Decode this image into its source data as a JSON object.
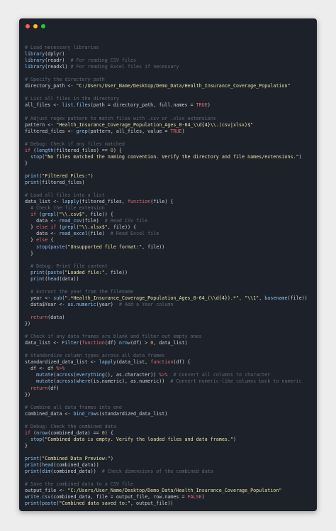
{
  "window": {
    "controls": [
      {
        "name": "close-dot",
        "color": "#ff5f56"
      },
      {
        "name": "minimize-dot",
        "color": "#ffbd2e"
      },
      {
        "name": "maximize-dot",
        "color": "#27c93f"
      }
    ]
  },
  "colors": {
    "background": "#1d2129",
    "comment": "#5f6a7a",
    "string": "#e8e1a6",
    "keyword": "#e06c75",
    "function": "#8cc3f5",
    "number": "#e4b679",
    "text": "#ccd2dc"
  },
  "code": [
    [],
    [
      [
        "cmt",
        "# Load necessary libraries"
      ]
    ],
    [
      [
        "fn",
        "library"
      ],
      [
        "op",
        "(dplyr)"
      ]
    ],
    [
      [
        "fn",
        "library"
      ],
      [
        "op",
        "(readr)  "
      ],
      [
        "cmt",
        "# For reading CSV files"
      ]
    ],
    [
      [
        "fn",
        "library"
      ],
      [
        "op",
        "(readxl) "
      ],
      [
        "cmt",
        "# For reading Excel files if necessary"
      ]
    ],
    [],
    [
      [
        "cmt",
        "# Specify the directory path"
      ]
    ],
    [
      [
        "id",
        "directory_path "
      ],
      [
        "op",
        "<- "
      ],
      [
        "str",
        "\"C:/Users/User_Name/Desktop/Demo_Data/Health_Insurance_Coverage_Population\""
      ]
    ],
    [],
    [
      [
        "cmt",
        "# List all files in the directory"
      ]
    ],
    [
      [
        "id",
        "all_files "
      ],
      [
        "op",
        "<- "
      ],
      [
        "fn",
        "list.files"
      ],
      [
        "op",
        "(path = directory_path, full.names = "
      ],
      [
        "kw",
        "TRUE"
      ],
      [
        "op",
        ")"
      ]
    ],
    [],
    [
      [
        "cmt",
        "# Adjust regex pattern to match files with .csv or .xlsx extensions"
      ]
    ],
    [
      [
        "id",
        "pattern "
      ],
      [
        "op",
        "<- "
      ],
      [
        "str",
        "\"Health_Insurance_Coverage_Population_Ages_0-64_\\\\d{4}\\\\.(csv|xlsx)$\""
      ]
    ],
    [
      [
        "id",
        "filtered_files "
      ],
      [
        "op",
        "<- "
      ],
      [
        "fn",
        "grep"
      ],
      [
        "op",
        "(pattern, all_files, value = "
      ],
      [
        "kw",
        "TRUE"
      ],
      [
        "op",
        ")"
      ]
    ],
    [],
    [
      [
        "cmt",
        "# Debug: Check if any files matched"
      ]
    ],
    [
      [
        "kw",
        "if"
      ],
      [
        "op",
        " ("
      ],
      [
        "fn",
        "length"
      ],
      [
        "op",
        "(filtered_files) == "
      ],
      [
        "num",
        "0"
      ],
      [
        "op",
        ") {"
      ]
    ],
    [
      [
        "op",
        "  "
      ],
      [
        "fn",
        "stop"
      ],
      [
        "op",
        "("
      ],
      [
        "str",
        "\"No files matched the naming convention. Verify the directory and file names/extensions.\""
      ],
      [
        "op",
        ")"
      ]
    ],
    [
      [
        "op",
        "}"
      ]
    ],
    [],
    [
      [
        "fn",
        "print"
      ],
      [
        "op",
        "("
      ],
      [
        "str",
        "\"Filtered Files:\""
      ],
      [
        "op",
        ")"
      ]
    ],
    [
      [
        "fn",
        "print"
      ],
      [
        "op",
        "(filtered_files)"
      ]
    ],
    [],
    [
      [
        "cmt",
        "# Load all files into a list"
      ]
    ],
    [
      [
        "id",
        "data_list "
      ],
      [
        "op",
        "<- "
      ],
      [
        "fn",
        "lapply"
      ],
      [
        "op",
        "(filtered_files, "
      ],
      [
        "kw",
        "function"
      ],
      [
        "op",
        "(file) {"
      ]
    ],
    [
      [
        "op",
        "  "
      ],
      [
        "cmt",
        "# Check the file extension"
      ]
    ],
    [
      [
        "op",
        "  "
      ],
      [
        "kw",
        "if"
      ],
      [
        "op",
        " ("
      ],
      [
        "fn",
        "grepl"
      ],
      [
        "op",
        "("
      ],
      [
        "str",
        "\"\\\\.csv$\""
      ],
      [
        "op",
        ", file)) {"
      ]
    ],
    [
      [
        "op",
        "    data <- "
      ],
      [
        "fn",
        "read_csv"
      ],
      [
        "op",
        "(file)  "
      ],
      [
        "cmt",
        "# Read CSV file"
      ]
    ],
    [
      [
        "op",
        "  } "
      ],
      [
        "kw",
        "else if"
      ],
      [
        "op",
        " ("
      ],
      [
        "fn",
        "grepl"
      ],
      [
        "op",
        "("
      ],
      [
        "str",
        "\"\\\\.xlsx$\""
      ],
      [
        "op",
        ", file)) {"
      ]
    ],
    [
      [
        "op",
        "    data <- "
      ],
      [
        "fn",
        "read_excel"
      ],
      [
        "op",
        "(file)  "
      ],
      [
        "cmt",
        "# Read Excel file"
      ]
    ],
    [
      [
        "op",
        "  } "
      ],
      [
        "kw",
        "else"
      ],
      [
        "op",
        " {"
      ]
    ],
    [
      [
        "op",
        "    "
      ],
      [
        "fn",
        "stop"
      ],
      [
        "op",
        "("
      ],
      [
        "fn",
        "paste"
      ],
      [
        "op",
        "("
      ],
      [
        "str",
        "\"Unsupported file format:\""
      ],
      [
        "op",
        ", file))"
      ]
    ],
    [
      [
        "op",
        "  }"
      ]
    ],
    [],
    [
      [
        "op",
        "  "
      ],
      [
        "cmt",
        "# Debug: Print file content"
      ]
    ],
    [
      [
        "op",
        "  "
      ],
      [
        "fn",
        "print"
      ],
      [
        "op",
        "("
      ],
      [
        "fn",
        "paste"
      ],
      [
        "op",
        "("
      ],
      [
        "str",
        "\"Loaded file:\""
      ],
      [
        "op",
        ", file))"
      ]
    ],
    [
      [
        "op",
        "  "
      ],
      [
        "fn",
        "print"
      ],
      [
        "op",
        "("
      ],
      [
        "fn",
        "head"
      ],
      [
        "op",
        "(data))"
      ]
    ],
    [],
    [
      [
        "op",
        "  "
      ],
      [
        "cmt",
        "# Extract the year from the filename"
      ]
    ],
    [
      [
        "op",
        "  year <- "
      ],
      [
        "fn",
        "sub"
      ],
      [
        "op",
        "("
      ],
      [
        "str",
        "\".*Health_Insurance_Coverage_Population_Ages_0-64_(\\\\d{4}).*\""
      ],
      [
        "op",
        ", "
      ],
      [
        "str",
        "\"\\\\1\""
      ],
      [
        "op",
        ", "
      ],
      [
        "fn",
        "basename"
      ],
      [
        "op",
        "(file))"
      ]
    ],
    [
      [
        "op",
        "  data$Year <- "
      ],
      [
        "fn",
        "as.numeric"
      ],
      [
        "op",
        "(year)  "
      ],
      [
        "cmt",
        "# Add a Year column"
      ]
    ],
    [],
    [
      [
        "op",
        "  "
      ],
      [
        "kw",
        "return"
      ],
      [
        "op",
        "(data)"
      ]
    ],
    [
      [
        "op",
        "})"
      ]
    ],
    [],
    [
      [
        "cmt",
        "# Check if any data frames are blank and filter out empty ones"
      ]
    ],
    [
      [
        "id",
        "data_list "
      ],
      [
        "op",
        "<- "
      ],
      [
        "fn",
        "Filter"
      ],
      [
        "op",
        "("
      ],
      [
        "kw",
        "function"
      ],
      [
        "op",
        "(df) "
      ],
      [
        "fn",
        "nrow"
      ],
      [
        "op",
        "(df) > "
      ],
      [
        "num",
        "0"
      ],
      [
        "op",
        ", data_list)"
      ]
    ],
    [],
    [
      [
        "cmt",
        "# Standardize column types across all data frames"
      ]
    ],
    [
      [
        "id",
        "standardized_data_list "
      ],
      [
        "op",
        "<- "
      ],
      [
        "fn",
        "lapply"
      ],
      [
        "op",
        "(data_list, "
      ],
      [
        "kw",
        "function"
      ],
      [
        "op",
        "(df) {"
      ]
    ],
    [
      [
        "op",
        "  df <- df "
      ],
      [
        "kw",
        "%>%"
      ]
    ],
    [
      [
        "op",
        "    "
      ],
      [
        "fn",
        "mutate"
      ],
      [
        "op",
        "("
      ],
      [
        "fn",
        "across"
      ],
      [
        "op",
        "("
      ],
      [
        "fn",
        "everything"
      ],
      [
        "op",
        "(), as.character)) "
      ],
      [
        "kw",
        "%>%"
      ],
      [
        "op",
        "  "
      ],
      [
        "cmt",
        "# Convert all columns to character"
      ]
    ],
    [
      [
        "op",
        "    "
      ],
      [
        "fn",
        "mutate"
      ],
      [
        "op",
        "("
      ],
      [
        "fn",
        "across"
      ],
      [
        "op",
        "("
      ],
      [
        "fn",
        "where"
      ],
      [
        "op",
        "(is.numeric), as.numeric))  "
      ],
      [
        "cmt",
        "# Convert numeric-like columns back to numeric"
      ]
    ],
    [
      [
        "op",
        "  "
      ],
      [
        "kw",
        "return"
      ],
      [
        "op",
        "(df)"
      ]
    ],
    [
      [
        "op",
        "})"
      ]
    ],
    [],
    [
      [
        "cmt",
        "# Combine all data frames into one"
      ]
    ],
    [
      [
        "id",
        "combined_data "
      ],
      [
        "op",
        "<- "
      ],
      [
        "fn",
        "bind_rows"
      ],
      [
        "op",
        "(standardized_data_list)"
      ]
    ],
    [],
    [
      [
        "cmt",
        "# Debug: Check the combined data"
      ]
    ],
    [
      [
        "kw",
        "if"
      ],
      [
        "op",
        " ("
      ],
      [
        "fn",
        "nrow"
      ],
      [
        "op",
        "(combined_data) == "
      ],
      [
        "num",
        "0"
      ],
      [
        "op",
        ") {"
      ]
    ],
    [
      [
        "op",
        "  "
      ],
      [
        "fn",
        "stop"
      ],
      [
        "op",
        "("
      ],
      [
        "str",
        "\"Combined data is empty. Verify the loaded files and data frames.\""
      ],
      [
        "op",
        ")"
      ]
    ],
    [
      [
        "op",
        "}"
      ]
    ],
    [],
    [
      [
        "fn",
        "print"
      ],
      [
        "op",
        "("
      ],
      [
        "str",
        "\"Combined Data Preview:\""
      ],
      [
        "op",
        ")"
      ]
    ],
    [
      [
        "fn",
        "print"
      ],
      [
        "op",
        "("
      ],
      [
        "fn",
        "head"
      ],
      [
        "op",
        "(combined_data))"
      ]
    ],
    [
      [
        "fn",
        "print"
      ],
      [
        "op",
        "("
      ],
      [
        "fn",
        "dim"
      ],
      [
        "op",
        "(combined_data))  "
      ],
      [
        "cmt",
        "# Check dimensions of the combined data"
      ]
    ],
    [],
    [
      [
        "cmt",
        "# Save the combined data to a CSV file"
      ]
    ],
    [
      [
        "id",
        "output_file "
      ],
      [
        "op",
        "<- "
      ],
      [
        "str",
        "\"C:/Users/User_Name/Desktop/Demo_Data/Health_Insurance_Coverage_Population\""
      ]
    ],
    [
      [
        "fn",
        "write.csv"
      ],
      [
        "op",
        "(combined_data, file = output_file, row.names = "
      ],
      [
        "kw",
        "FALSE"
      ],
      [
        "op",
        ")"
      ]
    ],
    [
      [
        "fn",
        "print"
      ],
      [
        "op",
        "("
      ],
      [
        "fn",
        "paste"
      ],
      [
        "op",
        "("
      ],
      [
        "str",
        "\"Combined data saved to:\""
      ],
      [
        "op",
        ", output_file))"
      ]
    ]
  ]
}
